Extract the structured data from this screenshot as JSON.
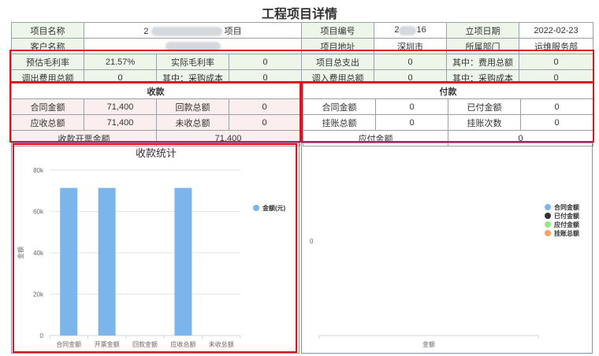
{
  "page": {
    "title": "工程项目详情"
  },
  "info": {
    "row1": {
      "project_name_label": "项目名称",
      "project_name_prefix": "2",
      "project_name_suffix": "项目",
      "project_no_label": "项目编号",
      "project_no_prefix": "2",
      "project_no_suffix": "16",
      "start_date_label": "立项日期",
      "start_date": "2022-02-23"
    },
    "row2": {
      "customer_label": "客户名称",
      "address_label": "项目地址",
      "address": "深圳市",
      "dept_label": "所属部门",
      "dept": "运维服务部"
    },
    "row3": {
      "est_margin_label": "预估毛利率",
      "est_margin": "21.57%",
      "actual_margin_label": "实际毛利率",
      "actual_margin": "0",
      "total_expense_label": "项目总支出",
      "total_expense": "0",
      "fee_total_label": "其中：费用总额",
      "fee_total": "0"
    },
    "row4": {
      "out_fee_label": "调出费用总额",
      "out_fee": "0",
      "purchase_cost_label": "其中：采购成本",
      "purchase_cost": "0",
      "in_fee_label": "调入费用总额",
      "in_fee": "0",
      "purchase_cost2_label": "其中：采购成本",
      "purchase_cost2": "0"
    }
  },
  "receipts": {
    "header": "收款",
    "contract_label": "合同金额",
    "contract": "71,400",
    "returned_label": "回款总额",
    "returned": "0",
    "receivable_label": "应收总额",
    "receivable": "71,400",
    "unreceived_label": "未收总额",
    "unreceived": "0",
    "invoice_label": "收款开票金额",
    "invoice": "71,400"
  },
  "payments": {
    "header": "付款",
    "contract_label": "合同金额",
    "contract": "0",
    "paid_label": "已付金额",
    "paid": "0",
    "pending_label": "挂账总额",
    "pending": "0",
    "pending_count_label": "挂账次数",
    "pending_count": "0",
    "payable_label": "应付金额",
    "payable": "0"
  },
  "colors": {
    "bar": "#7cb5ec",
    "red": "#e0141e",
    "dark": "#333333",
    "green": "#90ed7d",
    "orange": "#f7a35c"
  },
  "chart_data": [
    {
      "type": "bar",
      "title": "收款统计",
      "categories": [
        "合同金额",
        "开票金额",
        "回款金额",
        "应收总额",
        "未收总额"
      ],
      "series": [
        {
          "name": "金额(元)",
          "values": [
            71400,
            71400,
            0,
            71400,
            0
          ]
        }
      ],
      "ylabel": "金额",
      "ylim": [
        0,
        80000
      ],
      "yticks": [
        "0",
        "20k",
        "40k",
        "60k",
        "80k"
      ],
      "grid": true,
      "legend": "right"
    },
    {
      "type": "bar",
      "title": "",
      "categories": [
        "金额"
      ],
      "series": [
        {
          "name": "合同金额",
          "values": [
            0
          ]
        },
        {
          "name": "已付金额",
          "values": [
            0
          ]
        },
        {
          "name": "应付金额",
          "values": [
            0
          ]
        },
        {
          "name": "挂账总额",
          "values": [
            0
          ]
        }
      ],
      "yticks": [
        "0"
      ],
      "legend": "right"
    }
  ]
}
